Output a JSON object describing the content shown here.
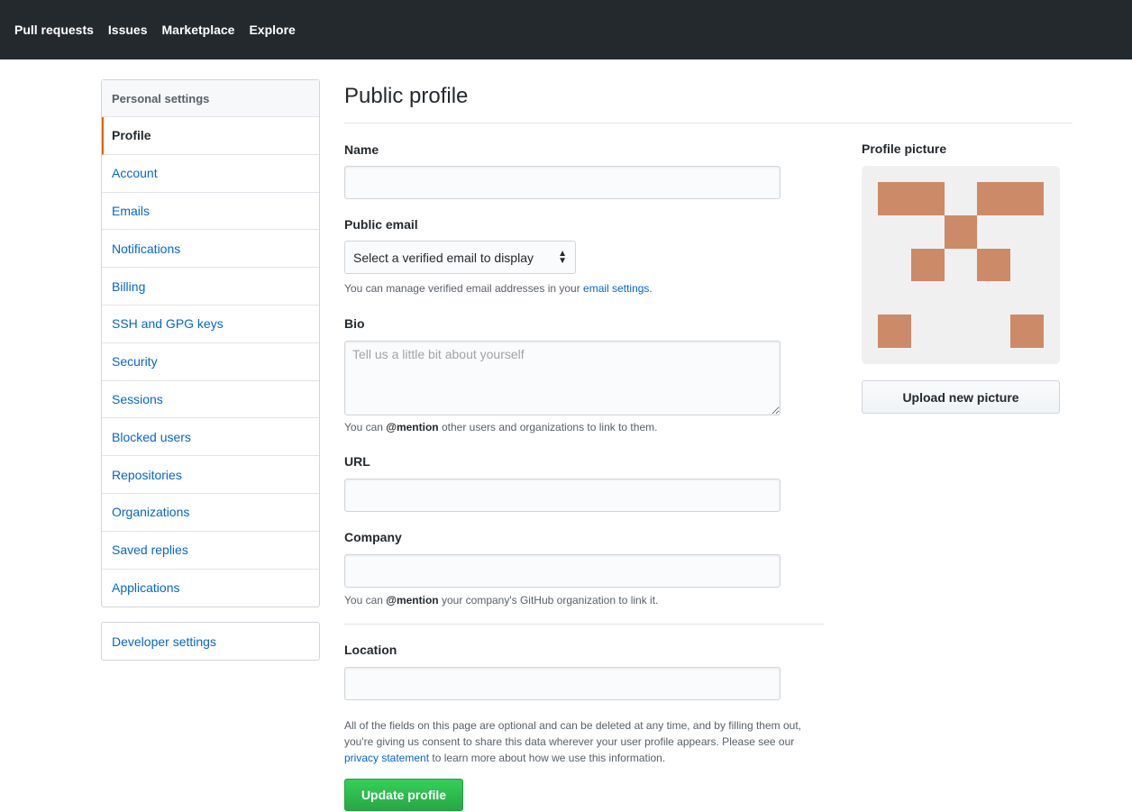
{
  "nav": {
    "items": [
      "Pull requests",
      "Issues",
      "Marketplace",
      "Explore"
    ]
  },
  "sidebar": {
    "header": "Personal settings",
    "items": [
      {
        "label": "Profile",
        "selected": true
      },
      {
        "label": "Account"
      },
      {
        "label": "Emails"
      },
      {
        "label": "Notifications"
      },
      {
        "label": "Billing"
      },
      {
        "label": "SSH and GPG keys"
      },
      {
        "label": "Security"
      },
      {
        "label": "Sessions"
      },
      {
        "label": "Blocked users"
      },
      {
        "label": "Repositories"
      },
      {
        "label": "Organizations"
      },
      {
        "label": "Saved replies"
      },
      {
        "label": "Applications"
      }
    ],
    "developer_settings": "Developer settings"
  },
  "main": {
    "title": "Public profile",
    "name": {
      "label": "Name",
      "value": ""
    },
    "public_email": {
      "label": "Public email",
      "selected": "Select a verified email to display",
      "note_prefix": "You can manage verified email addresses in your ",
      "note_link": "email settings",
      "note_suffix": "."
    },
    "bio": {
      "label": "Bio",
      "placeholder": "Tell us a little bit about yourself",
      "note_prefix": "You can ",
      "note_bold": "@mention",
      "note_suffix": " other users and organizations to link to them."
    },
    "url": {
      "label": "URL",
      "value": ""
    },
    "company": {
      "label": "Company",
      "value": "",
      "note_prefix": "You can ",
      "note_bold": "@mention",
      "note_suffix": " your company's GitHub organization to link it."
    },
    "location": {
      "label": "Location",
      "value": ""
    },
    "consent": {
      "line1": "All of the fields on this page are optional and can be deleted at any time, and by filling them out, you're giving us consent to share this data wherever your user profile appears. Please see our ",
      "link": "privacy statement",
      "line2": " to learn more about how we use this information."
    },
    "update_button": "Update profile"
  },
  "profile_picture": {
    "label": "Profile picture",
    "color": "#cc8a68",
    "upload_button": "Upload new picture"
  }
}
